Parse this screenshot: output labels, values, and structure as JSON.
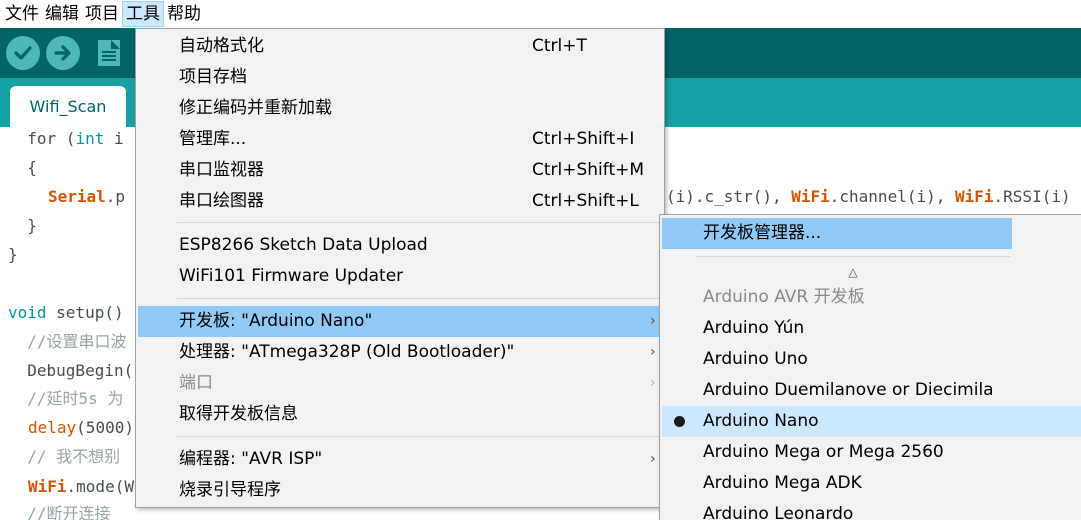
{
  "menubar": {
    "items": [
      "文件",
      "编辑",
      "项目",
      "工具",
      "帮助"
    ]
  },
  "toolbar": {
    "buttons": [
      "verify-button",
      "upload-button",
      "new-button"
    ]
  },
  "tabs": [
    {
      "label": "Wifi_Scan"
    }
  ],
  "code": {
    "lines": [
      {
        "a": "  for (",
        "kw": "int",
        "b": " i"
      },
      {
        "a": "  {"
      },
      {
        "obj": "Serial",
        "a": ".p"
      },
      {
        "a": "  }"
      },
      {
        "a": "}"
      },
      {
        "a": ""
      },
      {
        "kw": "void",
        "b": " setup()"
      },
      {
        "cm": "  //设置串口波"
      },
      {
        "a": "  DebugBegin("
      },
      {
        "cm": "  //延时5s 为"
      },
      {
        "fn": "delay",
        "a": "(5000)"
      },
      {
        "cm": "  // 我不想别"
      },
      {
        "obj": "WiFi",
        "a": ".mode(W"
      },
      {
        "cm": "  //断开连接"
      }
    ],
    "right_fragment": {
      "a": "(i).c_str(), ",
      "obj1": "WiFi",
      "b": ".channel(i), ",
      "obj2": "WiFi",
      "c": ".RSSI(i)"
    }
  },
  "tools_menu": {
    "items": [
      {
        "label": "自动格式化",
        "shortcut": "Ctrl+T"
      },
      {
        "label": "项目存档",
        "shortcut": ""
      },
      {
        "label": "修正编码并重新加载",
        "shortcut": ""
      },
      {
        "label": "管理库...",
        "shortcut": "Ctrl+Shift+I"
      },
      {
        "label": "串口监视器",
        "shortcut": "Ctrl+Shift+M"
      },
      {
        "label": "串口绘图器",
        "shortcut": "Ctrl+Shift+L"
      },
      {
        "label": "ESP8266 Sketch Data Upload",
        "shortcut": ""
      },
      {
        "label": "WiFi101 Firmware Updater",
        "shortcut": ""
      },
      {
        "label": "开发板: \"Arduino Nano\"",
        "shortcut": ""
      },
      {
        "label": "处理器: \"ATmega328P (Old Bootloader)\"",
        "shortcut": ""
      },
      {
        "label": "端口",
        "shortcut": ""
      },
      {
        "label": "取得开发板信息",
        "shortcut": ""
      },
      {
        "label": "编程器: \"AVR ISP\"",
        "shortcut": ""
      },
      {
        "label": "烧录引导程序",
        "shortcut": ""
      }
    ],
    "submenu_arrow": "›"
  },
  "board_submenu": {
    "manager": "开发板管理器...",
    "scroll_up": "△",
    "group_header": "Arduino AVR 开发板",
    "boards": [
      "Arduino Yún",
      "Arduino Uno",
      "Arduino Duemilanove or Diecimila",
      "Arduino Nano",
      "Arduino Mega or Mega 2560",
      "Arduino Mega ADK",
      "Arduino Leonardo"
    ],
    "selected": "Arduino Nano"
  },
  "colors": {
    "toolbar": "#006468",
    "tabbar": "#17a1a5",
    "menu_highlight": "#91c9f7",
    "keyword": "#00979c",
    "object": "#d35400"
  }
}
